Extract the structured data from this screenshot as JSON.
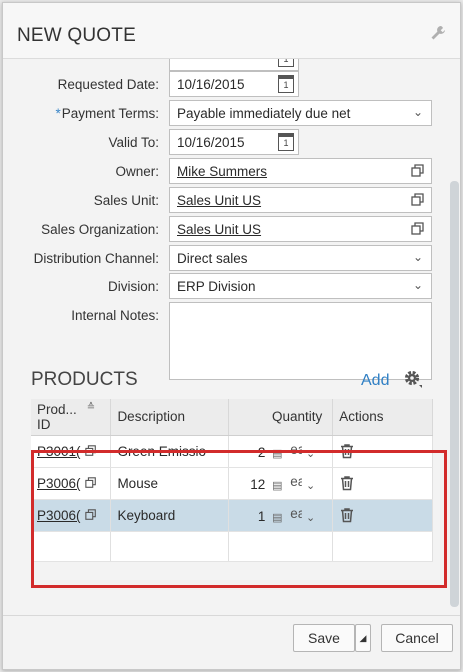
{
  "dialog": {
    "title": "NEW QUOTE"
  },
  "form": {
    "requested_date": {
      "label": "Requested Date:",
      "value": "10/16/2015"
    },
    "payment_terms": {
      "required_mark": "*",
      "label": "Payment Terms:",
      "value": "Payable immediately due net"
    },
    "valid_to": {
      "label": "Valid To:",
      "value": "10/16/2015"
    },
    "owner": {
      "label": "Owner:",
      "value": "Mike Summers"
    },
    "sales_unit": {
      "label": "Sales Unit:",
      "value": "Sales Unit US"
    },
    "sales_org": {
      "label": "Sales Organization:",
      "value": "Sales Unit US"
    },
    "distribution_channel": {
      "label": "Distribution Channel:",
      "value": "Direct sales"
    },
    "division": {
      "label": "Division:",
      "value": "ERP Division"
    },
    "internal_notes": {
      "label": "Internal Notes:",
      "value": ""
    }
  },
  "products": {
    "title": "PRODUCTS",
    "add_label": "Add",
    "columns": {
      "product_id": "Prod... ID",
      "description": "Description",
      "quantity": "Quantity",
      "actions": "Actions"
    },
    "rows": [
      {
        "id": "P3001(",
        "description": "Green Emissio",
        "qty": "2",
        "unit": "ea"
      },
      {
        "id": "P3006(",
        "description": "Mouse",
        "qty": "12",
        "unit": "ea"
      },
      {
        "id": "P3006(",
        "description": "Keyboard",
        "qty": "1",
        "unit": "ea"
      }
    ]
  },
  "footer": {
    "save_label": "Save",
    "cancel_label": "Cancel"
  },
  "colors": {
    "accent": "#2f7fc4",
    "highlight_border": "#d22b2b",
    "selected_row": "#c9dbe7"
  }
}
